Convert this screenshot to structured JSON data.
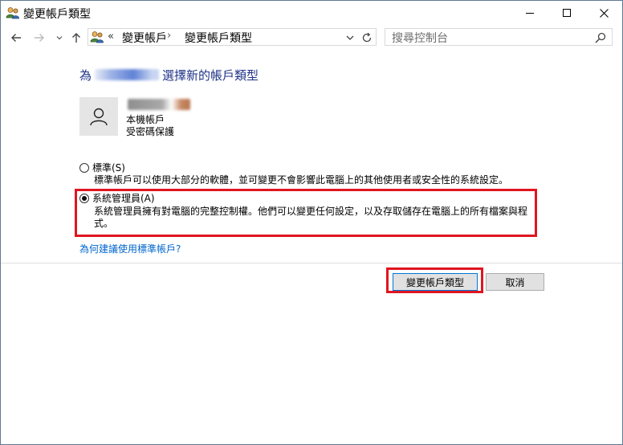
{
  "window": {
    "title": "變更帳戶類型"
  },
  "address": {
    "chevrons": "«",
    "crumb1": "變更帳戶",
    "separator": "›",
    "crumb2": "變更帳戶類型"
  },
  "search": {
    "placeholder": "搜尋控制台"
  },
  "content": {
    "heading_prefix": "為",
    "heading_suffix": "選擇新的帳戶類型",
    "account": {
      "type_line": "本機帳戶",
      "protect_line": "受密碼保護"
    },
    "options": [
      {
        "label": "標準(S)",
        "description": "標準帳戶可以使用大部分的軟體，並可變更不會影響此電腦上的其他使用者或安全性的系統設定。",
        "selected": false
      },
      {
        "label": "系統管理員(A)",
        "description_line1": "系統管理員擁有對電腦的完整控制權。他們可以變更任何設定，以及存取儲存在電腦上的所有檔案與程",
        "description_line2": "式。",
        "selected": true
      }
    ],
    "link": "為何建議使用標準帳戶?"
  },
  "buttons": {
    "primary": "變更帳戶類型",
    "cancel": "取消"
  },
  "colors": {
    "heading": "#1e3287",
    "link": "#0066cc",
    "highlight": "#e0151f",
    "primary_border": "#0078d7"
  },
  "icons": [
    "users-icon",
    "minimize-icon",
    "maximize-icon",
    "close-icon",
    "back-arrow-icon",
    "forward-arrow-icon",
    "recent-dropdown-icon",
    "up-arrow-icon",
    "chevron-down-icon",
    "refresh-icon",
    "search-icon",
    "user-avatar-icon"
  ]
}
